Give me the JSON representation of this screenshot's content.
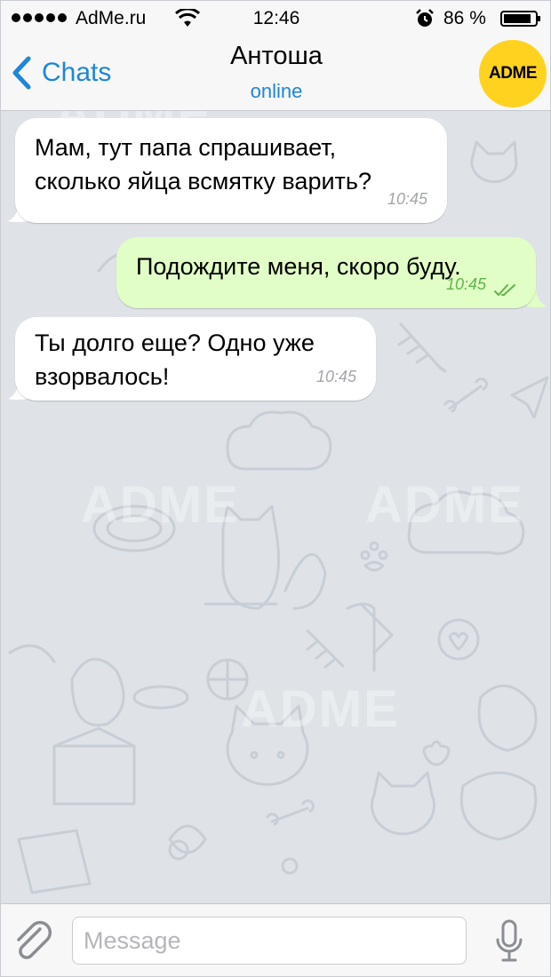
{
  "status_bar": {
    "carrier": "AdMe.ru",
    "time": "12:46",
    "battery": "86 %"
  },
  "nav": {
    "back_label": "Chats",
    "contact_name": "Антоша",
    "contact_status": "online",
    "avatar_text": "ADME"
  },
  "messages": [
    {
      "direction": "incoming",
      "lines": [
        "Мам, тут папа спрашивает,",
        "сколько яйца всмятку варить?"
      ],
      "time": "10:45"
    },
    {
      "direction": "outgoing",
      "lines": [
        "Подождите меня, скоро буду."
      ],
      "time": "10:45",
      "read": true
    },
    {
      "direction": "incoming",
      "lines": [
        "Ты долго еще? Одно уже",
        "взорвалось!"
      ],
      "time": "10:45"
    }
  ],
  "input": {
    "placeholder": "Message"
  },
  "watermark": "ADME",
  "colors": {
    "accent_blue": "#1d86d8",
    "outgoing_bubble": "#e1fec6",
    "incoming_bubble": "#ffffff",
    "chat_background": "#dfe3e8",
    "avatar_yellow": "#ffd21f",
    "read_check_green": "#5fb44b"
  },
  "icons": [
    "wifi-icon",
    "alarm-icon",
    "battery-icon",
    "back-chevron-icon",
    "double-check-icon",
    "paperclip-icon",
    "microphone-icon"
  ]
}
